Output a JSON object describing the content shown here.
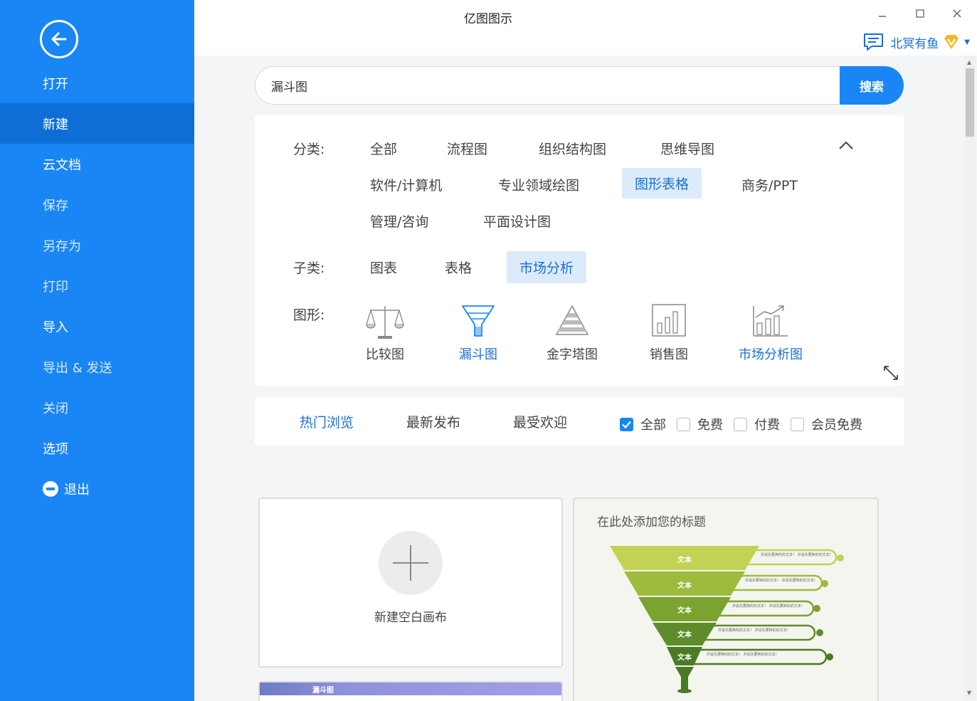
{
  "window": {
    "title": "亿图图示"
  },
  "user": {
    "name": "北冥有鱼"
  },
  "sidebar": {
    "items": [
      {
        "label": "打开"
      },
      {
        "label": "新建"
      },
      {
        "label": "云文档"
      },
      {
        "label": "保存"
      },
      {
        "label": "另存为"
      },
      {
        "label": "打印"
      },
      {
        "label": "导入"
      },
      {
        "label": "导出 & 发送"
      },
      {
        "label": "关闭"
      },
      {
        "label": "选项"
      },
      {
        "label": "退出"
      }
    ],
    "active": "新建"
  },
  "search": {
    "value": "漏斗图",
    "button_label": "搜索"
  },
  "filter": {
    "category_label": "分类:",
    "categories": [
      "全部",
      "流程图",
      "组织结构图",
      "思维导图",
      "软件/计算机",
      "专业领域绘图",
      "图形表格",
      "商务/PPT",
      "管理/咨询",
      "平面设计图"
    ],
    "selected_category": "图形表格",
    "subcategory_label": "子类:",
    "subcategories": [
      "图表",
      "表格",
      "市场分析"
    ],
    "selected_subcategory": "市场分析",
    "shape_label": "图形:",
    "shapes": [
      {
        "label": "比较图",
        "icon": "scale-icon"
      },
      {
        "label": "漏斗图",
        "icon": "funnel-icon"
      },
      {
        "label": "金字塔图",
        "icon": "pyramid-icon"
      },
      {
        "label": "销售图",
        "icon": "bar-chart-icon"
      },
      {
        "label": "市场分析图",
        "icon": "growth-chart-icon"
      }
    ],
    "selected_shape": "漏斗图"
  },
  "sort": {
    "tabs": [
      "热门浏览",
      "最新发布",
      "最受欢迎"
    ],
    "active_tab": "热门浏览",
    "checks": [
      {
        "label": "全部",
        "checked": true
      },
      {
        "label": "免费",
        "checked": false
      },
      {
        "label": "付费",
        "checked": false
      },
      {
        "label": "会员免费",
        "checked": false
      }
    ]
  },
  "cards": {
    "new_blank_label": "新建空白画布",
    "template_title": "在此处添加您的标题",
    "template_funnel_label": "文本",
    "template_callout_text": "并说先要换的的文本！ 并说先要换的的文本！",
    "strip_label": "漏斗图"
  },
  "colors": {
    "accent": "#1a86f5",
    "sidebar_active": "#0d6fd6",
    "chip_selected_bg": "#dcebfb"
  }
}
